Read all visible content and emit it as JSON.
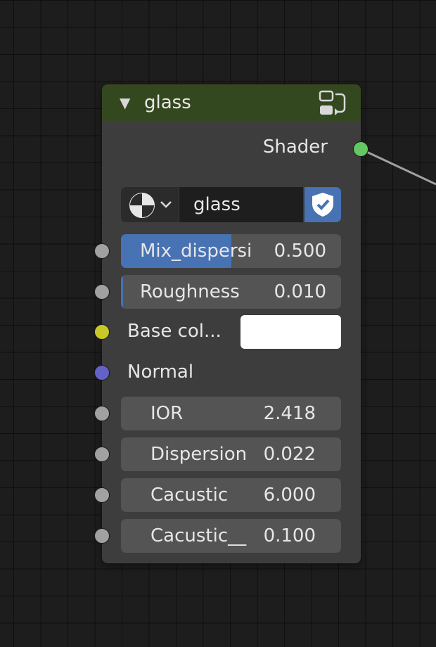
{
  "node": {
    "title": "glass",
    "output_label": "Shader",
    "material_name": "glass",
    "base_color_label": "Base col...",
    "base_color_value": "#ffffff",
    "normal_label": "Normal",
    "fields": [
      {
        "label": "Mix_dispersi",
        "value": "0.500",
        "fill_fraction": 0.5
      },
      {
        "label": "Roughness",
        "value": "0.010",
        "fill_fraction": 0.01
      },
      {
        "label": "IOR",
        "value": "2.418"
      },
      {
        "label": "Dispersion",
        "value": "0.022"
      },
      {
        "label": "Cacustic",
        "value": "6.000"
      },
      {
        "label": "Cacustic__",
        "value": "0.100"
      }
    ]
  },
  "colors": {
    "header": "#34481f",
    "accent": "#4772b3",
    "socket_shader": "#63c763",
    "socket_float": "#a1a1a1",
    "socket_color": "#c7c729",
    "socket_vector": "#6363c7"
  },
  "icons": {
    "collapse": "triangle-down-icon",
    "header": "node-group-swap-icon",
    "preview": "material-sphere-icon",
    "dropdown": "chevron-down-icon",
    "fake_user": "shield-check-icon"
  }
}
